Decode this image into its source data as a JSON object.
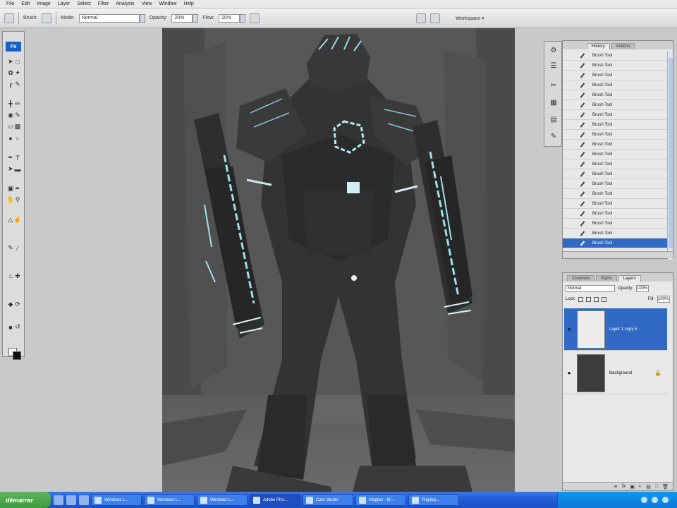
{
  "menu": [
    "File",
    "Edit",
    "Image",
    "Layer",
    "Select",
    "Filter",
    "Analysis",
    "View",
    "Window",
    "Help"
  ],
  "options": {
    "tool_label": "Brush:",
    "mode_label": "Mode:",
    "mode_value": "Normal",
    "opacity_label": "Opacity:",
    "opacity_value": "20%",
    "flow_label": "Flow:",
    "flow_value": "20%",
    "workspace_label": "Workspace ▾"
  },
  "history": {
    "tabs": [
      "History",
      "Actions"
    ],
    "items": [
      "Brush Tool",
      "Brush Tool",
      "Brush Tool",
      "Brush Tool",
      "Brush Tool",
      "Brush Tool",
      "Brush Tool",
      "Brush Tool",
      "Brush Tool",
      "Brush Tool",
      "Brush Tool",
      "Brush Tool",
      "Brush Tool",
      "Brush Tool",
      "Brush Tool",
      "Brush Tool",
      "Brush Tool",
      "Brush Tool",
      "Brush Tool",
      "Brush Tool"
    ],
    "selected_index": 19
  },
  "layers_panel": {
    "tabs": [
      "Channels",
      "Paths",
      "Layers"
    ],
    "blend_mode": "Normal",
    "opacity_label": "Opacity:",
    "opacity_value": "100%",
    "lock_label": "Lock:",
    "fill_label": "Fill:",
    "fill_value": "100%",
    "layers": [
      {
        "name": "Layer 1 copy 5",
        "selected": true
      },
      {
        "name": "Background",
        "selected": false
      }
    ]
  },
  "taskbar": {
    "start": "démarrer",
    "buttons": [
      "Windows L...",
      "Windows L...",
      "Windows L...",
      "Adobe Pho...",
      "Cam Studio",
      "Mapper - M...",
      "Playing..."
    ],
    "active_index": 3,
    "clock": ""
  }
}
